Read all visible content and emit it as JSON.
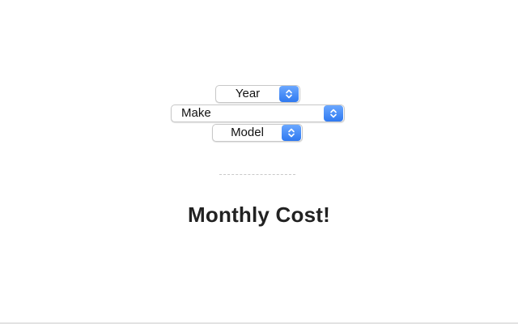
{
  "form": {
    "year_select": {
      "selected": "Year"
    },
    "make_select": {
      "selected": "Make"
    },
    "model_select": {
      "selected": "Model"
    }
  },
  "result": {
    "title": "Monthly Cost!"
  },
  "colors": {
    "accent": "#2f79f0",
    "title_text": "#222222"
  },
  "icons": {
    "select_stepper": "chevron-up-down-icon"
  }
}
